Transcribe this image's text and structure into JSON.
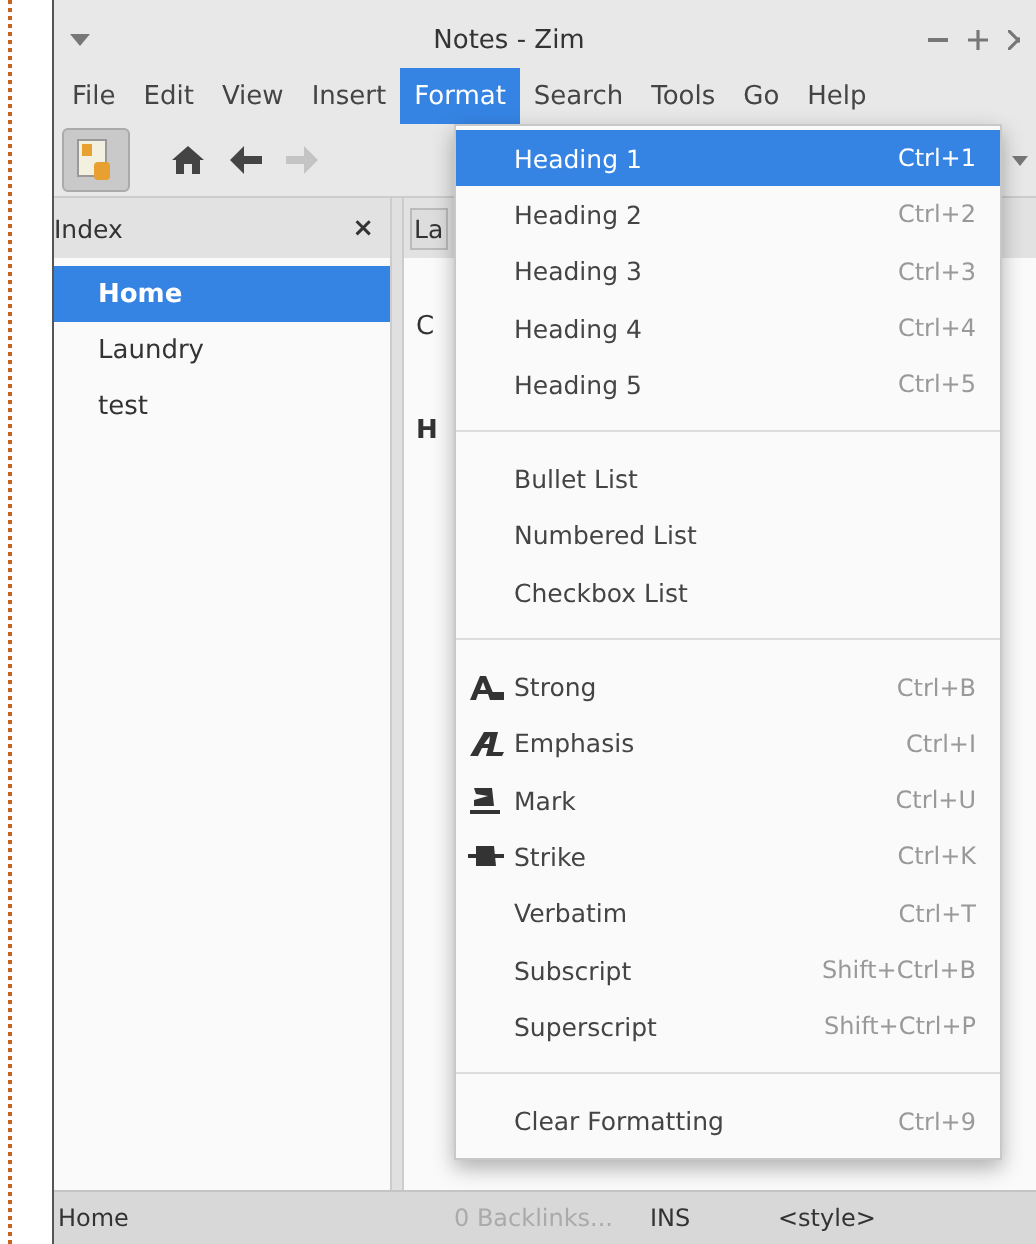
{
  "window": {
    "title": "Notes - Zim"
  },
  "menubar": [
    {
      "label": "File",
      "selected": false
    },
    {
      "label": "Edit",
      "selected": false
    },
    {
      "label": "View",
      "selected": false
    },
    {
      "label": "Insert",
      "selected": false
    },
    {
      "label": "Format",
      "selected": true
    },
    {
      "label": "Search",
      "selected": false
    },
    {
      "label": "Tools",
      "selected": false
    },
    {
      "label": "Go",
      "selected": false
    },
    {
      "label": "Help",
      "selected": false
    }
  ],
  "toolbar": {
    "forward_disabled": true
  },
  "index": {
    "title": "Index",
    "close": "×",
    "items": [
      {
        "label": "Home",
        "selected": true
      },
      {
        "label": "Laundry",
        "selected": false
      },
      {
        "label": "test",
        "selected": false
      }
    ]
  },
  "editor": {
    "tab": "La",
    "lines": [
      "C",
      "H"
    ]
  },
  "format_menu": {
    "sections": [
      [
        {
          "kind": "plain",
          "label": "Heading 1",
          "shortcut": "Ctrl+1",
          "selected": true
        },
        {
          "kind": "plain",
          "label": "Heading 2",
          "shortcut": "Ctrl+2",
          "selected": false
        },
        {
          "kind": "plain",
          "label": "Heading 3",
          "shortcut": "Ctrl+3",
          "selected": false
        },
        {
          "kind": "plain",
          "label": "Heading 4",
          "shortcut": "Ctrl+4",
          "selected": false
        },
        {
          "kind": "plain",
          "label": "Heading 5",
          "shortcut": "Ctrl+5",
          "selected": false
        }
      ],
      [
        {
          "kind": "plain",
          "label": "Bullet List",
          "selected": false
        },
        {
          "kind": "plain",
          "label": "Numbered List",
          "selected": false
        },
        {
          "kind": "plain",
          "label": "Checkbox List",
          "selected": false
        }
      ],
      [
        {
          "kind": "strong",
          "label": "Strong",
          "shortcut": "Ctrl+B",
          "selected": false
        },
        {
          "kind": "emphasis",
          "label": "Emphasis",
          "shortcut": "Ctrl+I",
          "selected": false
        },
        {
          "kind": "mark",
          "label": "Mark",
          "shortcut": "Ctrl+U",
          "selected": false
        },
        {
          "kind": "strike",
          "label": "Strike",
          "shortcut": "Ctrl+K",
          "selected": false
        },
        {
          "kind": "plain",
          "label": "Verbatim",
          "shortcut": "Ctrl+T",
          "selected": false
        },
        {
          "kind": "plain",
          "label": "Subscript",
          "shortcut": "Shift+Ctrl+B",
          "selected": false
        },
        {
          "kind": "plain",
          "label": "Superscript",
          "shortcut": "Shift+Ctrl+P",
          "selected": false
        }
      ],
      [
        {
          "kind": "plain",
          "label": "Clear Formatting",
          "shortcut": "Ctrl+9",
          "selected": false
        }
      ]
    ]
  },
  "status_bar": {
    "page": "Home",
    "backlinks": "0 Backlinks...",
    "mode": "INS",
    "style": "<style>"
  }
}
